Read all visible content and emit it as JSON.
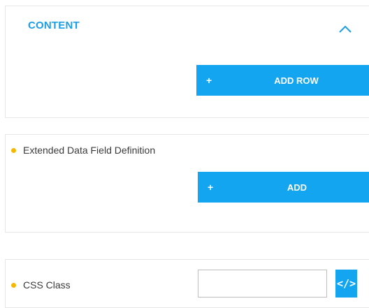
{
  "content_section": {
    "title": "CONTENT",
    "collapse_icon": "chevron-up-icon",
    "add_row_button": {
      "icon": "+",
      "label": "ADD ROW"
    }
  },
  "extended_section": {
    "label": "Extended Data Field Definition",
    "add_button": {
      "icon": "+",
      "label": "ADD"
    }
  },
  "css_section": {
    "label": "CSS Class",
    "input_value": "",
    "code_button_icon": "</>"
  },
  "colors": {
    "accent": "#13a5f0",
    "title_blue": "#1b9ee6",
    "required_dot": "#f5b800",
    "border": "#e6e6e6"
  }
}
